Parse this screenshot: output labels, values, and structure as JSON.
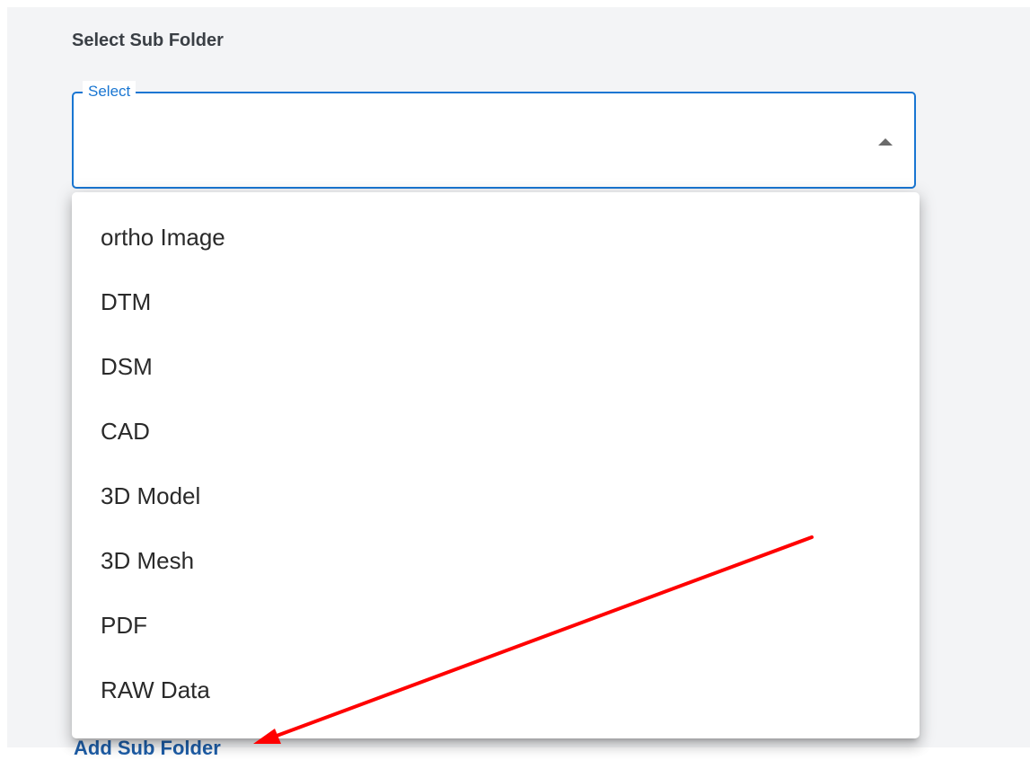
{
  "form": {
    "section_title": "Select Sub Folder",
    "select_label": "Select",
    "select_value": ""
  },
  "menu": {
    "items": [
      {
        "label": "ortho Image"
      },
      {
        "label": "DTM"
      },
      {
        "label": "DSM"
      },
      {
        "label": "CAD"
      },
      {
        "label": "3D Model"
      },
      {
        "label": "3D Mesh"
      },
      {
        "label": "PDF"
      },
      {
        "label": "RAW Data"
      }
    ]
  },
  "footer": {
    "link_label": "Add Sub Folder"
  },
  "colors": {
    "accent": "#1976d2",
    "annotation_arrow": "#ff0000",
    "panel_background": "#f3f4f6"
  },
  "icons": {
    "select_toggle": "triangle-up-icon"
  }
}
